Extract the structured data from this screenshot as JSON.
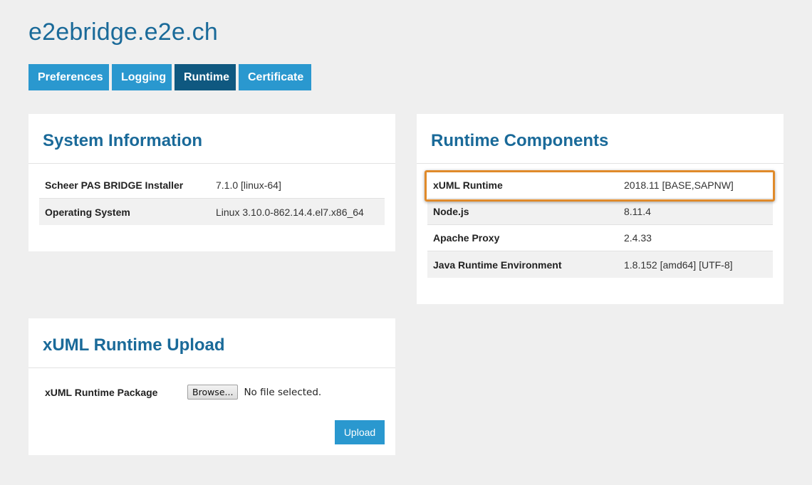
{
  "site": {
    "title": "e2ebridge.e2e.ch"
  },
  "tabs": [
    {
      "label": "Preferences",
      "active": false
    },
    {
      "label": "Logging",
      "active": false
    },
    {
      "label": "Runtime",
      "active": true
    },
    {
      "label": "Certificate",
      "active": false
    }
  ],
  "system_information": {
    "title": "System Information",
    "rows": [
      {
        "key": "Scheer PAS BRIDGE Installer",
        "value": "7.1.0 [linux-64]"
      },
      {
        "key": "Operating System",
        "value": "Linux 3.10.0-862.14.4.el7.x86_64"
      }
    ]
  },
  "runtime_components": {
    "title": "Runtime Components",
    "highlighted_row": "xUML Runtime",
    "rows": [
      {
        "key": "xUML Runtime",
        "value": "2018.11 [BASE,SAPNW]"
      },
      {
        "key": "Node.js",
        "value": "8.11.4"
      },
      {
        "key": "Apache Proxy",
        "value": "2.4.33"
      },
      {
        "key": "Java Runtime Environment",
        "value": "1.8.152 [amd64] [UTF-8]"
      }
    ]
  },
  "upload": {
    "title": "xUML Runtime Upload",
    "package_label": "xUML Runtime Package",
    "browse_label": "Browse...",
    "file_status": "No file selected.",
    "upload_label": "Upload"
  },
  "colors": {
    "accent": "#2a98cf",
    "active_tab": "#0f5880",
    "title": "#1a6a99",
    "highlight": "#e08a2a",
    "background": "#efefef"
  }
}
